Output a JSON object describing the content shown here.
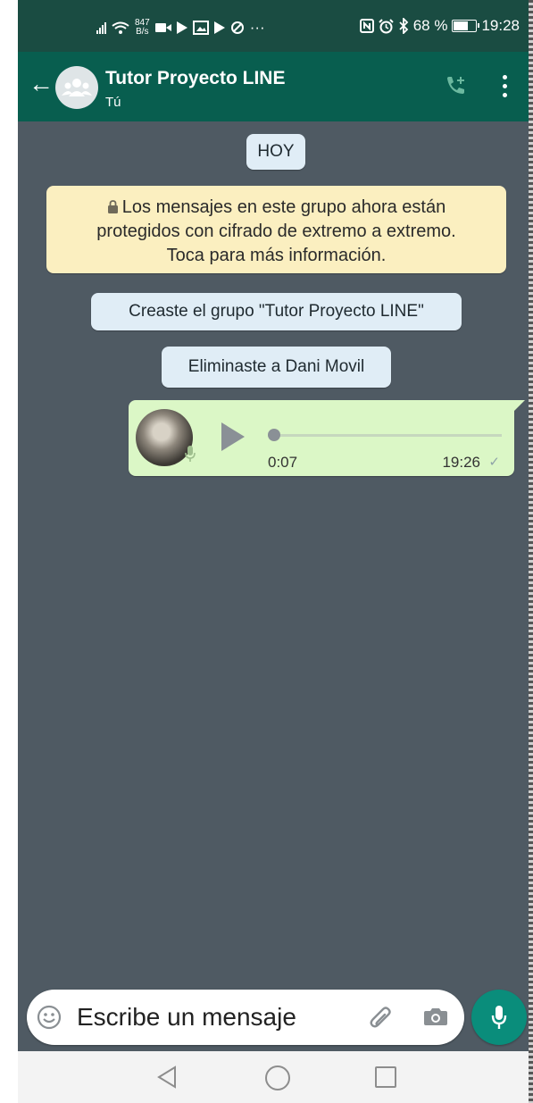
{
  "status_bar": {
    "net_speed_value": "847",
    "net_speed_unit": "B/s",
    "battery": "68 %",
    "clock": "19:28",
    "overflow": "···"
  },
  "header": {
    "back_icon": "arrow-left-icon",
    "avatar_icon": "group-avatar-icon",
    "title": "Tutor Proyecto LINE",
    "subtitle": "Tú",
    "call_icon": "add-call-icon",
    "menu_icon": "more-vert-icon"
  },
  "chat": {
    "date_label": "HOY",
    "encryption_notice": {
      "line1": "Los mensajes en este grupo ahora están",
      "line2": "protegidos con cifrado de extremo a extremo.",
      "line3": "Toca para más información."
    },
    "system_messages": [
      "Creaste el grupo \"Tutor Proyecto LINE\"",
      "Eliminaste a Dani Movil"
    ],
    "voice_message": {
      "duration": "0:07",
      "time": "19:26",
      "status_icon": "check-icon",
      "progress": 0
    }
  },
  "composer": {
    "placeholder": "Escribe un mensaje",
    "mic_icon": "mic-icon"
  },
  "colors": {
    "status_bar": "#1a4c42",
    "app_bar": "#085e4f",
    "chat_bg": "#4f5a63",
    "outgoing_bubble": "#dbf7c6",
    "encryption_bg": "#fbefc0",
    "system_pill": "#e0edf6",
    "fab": "#0a8d7b"
  }
}
